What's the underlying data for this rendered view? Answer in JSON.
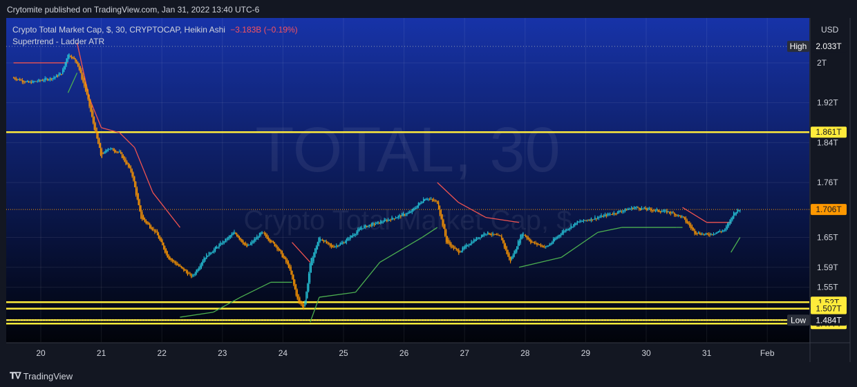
{
  "header": {
    "published_text": "Crytomite published on TradingView.com, Jan 31, 2022 13:40 UTC-6"
  },
  "legend": {
    "symbol": "Crypto Total Market Cap, $, 30, CRYPTOCAP, Heikin Ashi",
    "change": "−3.183B (−0.19%)",
    "indicator": "Supertrend - Ladder ATR"
  },
  "watermark": {
    "line1": "TOTAL, 30",
    "line2": "Crypto Total Market Cap, $"
  },
  "footer": {
    "brand": "TradingView"
  },
  "colors": {
    "background": "#131722",
    "gradient_top": "#1733a8",
    "gradient_bottom": "#010309",
    "candle_up": "#26c6da",
    "candle_down": "#ff9800",
    "supertrend_down": "#ef5350",
    "supertrend_up": "#4caf50",
    "hline": "#ffeb3b",
    "last_price_line": "#ff9800"
  },
  "chart_data": {
    "type": "candlestick",
    "chart_style": "Heikin Ashi",
    "timeframe": "30",
    "currency": "USD",
    "y_scale_labels": [
      "2T",
      "1.92T",
      "1.84T",
      "1.76T",
      "1.65T",
      "1.59T",
      "1.55T"
    ],
    "y_unit_label": "USD",
    "x_tick_labels": [
      "20",
      "21",
      "22",
      "23",
      "24",
      "25",
      "26",
      "27",
      "28",
      "29",
      "30",
      "31",
      "Feb"
    ],
    "price_range_T": [
      1.44,
      2.09
    ],
    "horizontal_lines": [
      {
        "value": 1.861,
        "label": "1.861T"
      },
      {
        "value": 1.52,
        "label": "1.52T"
      },
      {
        "value": 1.507,
        "label": "1.507T"
      },
      {
        "value": 1.484,
        "label": "1.484T"
      },
      {
        "value": 1.477,
        "label": "1.477T"
      }
    ],
    "high": {
      "label": "High",
      "value": 2.033,
      "value_label": "2.033T"
    },
    "low": {
      "label": "Low",
      "value": 1.484,
      "value_label": "1.484T"
    },
    "last_price": {
      "value": 1.706,
      "label": "1.706T"
    },
    "price_path": [
      {
        "day": 19.55,
        "price": 1.97
      },
      {
        "day": 19.8,
        "price": 1.96
      },
      {
        "day": 20.2,
        "price": 1.97
      },
      {
        "day": 20.35,
        "price": 1.98
      },
      {
        "day": 20.45,
        "price": 2.02
      },
      {
        "day": 20.6,
        "price": 2.0
      },
      {
        "day": 20.75,
        "price": 1.94
      },
      {
        "day": 20.9,
        "price": 1.86
      },
      {
        "day": 21.0,
        "price": 1.81
      },
      {
        "day": 21.1,
        "price": 1.83
      },
      {
        "day": 21.3,
        "price": 1.82
      },
      {
        "day": 21.5,
        "price": 1.78
      },
      {
        "day": 21.65,
        "price": 1.69
      },
      {
        "day": 21.9,
        "price": 1.66
      },
      {
        "day": 22.1,
        "price": 1.61
      },
      {
        "day": 22.3,
        "price": 1.59
      },
      {
        "day": 22.5,
        "price": 1.57
      },
      {
        "day": 22.7,
        "price": 1.61
      },
      {
        "day": 23.0,
        "price": 1.64
      },
      {
        "day": 23.2,
        "price": 1.66
      },
      {
        "day": 23.4,
        "price": 1.63
      },
      {
        "day": 23.65,
        "price": 1.66
      },
      {
        "day": 23.9,
        "price": 1.63
      },
      {
        "day": 24.1,
        "price": 1.59
      },
      {
        "day": 24.25,
        "price": 1.52
      },
      {
        "day": 24.35,
        "price": 1.51
      },
      {
        "day": 24.45,
        "price": 1.6
      },
      {
        "day": 24.6,
        "price": 1.65
      },
      {
        "day": 24.8,
        "price": 1.63
      },
      {
        "day": 25.0,
        "price": 1.64
      },
      {
        "day": 25.3,
        "price": 1.67
      },
      {
        "day": 25.6,
        "price": 1.68
      },
      {
        "day": 25.85,
        "price": 1.69
      },
      {
        "day": 26.1,
        "price": 1.7
      },
      {
        "day": 26.35,
        "price": 1.73
      },
      {
        "day": 26.55,
        "price": 1.72
      },
      {
        "day": 26.7,
        "price": 1.64
      },
      {
        "day": 26.9,
        "price": 1.62
      },
      {
        "day": 27.1,
        "price": 1.64
      },
      {
        "day": 27.35,
        "price": 1.66
      },
      {
        "day": 27.6,
        "price": 1.65
      },
      {
        "day": 27.75,
        "price": 1.6
      },
      {
        "day": 27.95,
        "price": 1.66
      },
      {
        "day": 28.1,
        "price": 1.64
      },
      {
        "day": 28.35,
        "price": 1.63
      },
      {
        "day": 28.6,
        "price": 1.66
      },
      {
        "day": 28.85,
        "price": 1.68
      },
      {
        "day": 29.2,
        "price": 1.69
      },
      {
        "day": 29.5,
        "price": 1.7
      },
      {
        "day": 29.8,
        "price": 1.71
      },
      {
        "day": 30.1,
        "price": 1.705
      },
      {
        "day": 30.4,
        "price": 1.7
      },
      {
        "day": 30.6,
        "price": 1.69
      },
      {
        "day": 30.8,
        "price": 1.66
      },
      {
        "day": 31.0,
        "price": 1.655
      },
      {
        "day": 31.3,
        "price": 1.665
      },
      {
        "day": 31.45,
        "price": 1.7
      },
      {
        "day": 31.55,
        "price": 1.706
      }
    ],
    "supertrend": [
      {
        "day": 19.55,
        "price": 2.0,
        "dir": "down"
      },
      {
        "day": 20.45,
        "price": 2.0,
        "dir": "down"
      },
      {
        "day": 20.45,
        "price": 1.94,
        "dir": "up"
      },
      {
        "day": 20.6,
        "price": 1.98,
        "dir": "up"
      },
      {
        "day": 20.6,
        "price": 2.04,
        "dir": "down"
      },
      {
        "day": 20.8,
        "price": 1.93,
        "dir": "down"
      },
      {
        "day": 21.0,
        "price": 1.87,
        "dir": "down"
      },
      {
        "day": 21.3,
        "price": 1.86,
        "dir": "down"
      },
      {
        "day": 21.55,
        "price": 1.83,
        "dir": "down"
      },
      {
        "day": 21.85,
        "price": 1.74,
        "dir": "down"
      },
      {
        "day": 22.3,
        "price": 1.67,
        "dir": "down"
      },
      {
        "day": 22.3,
        "price": 1.49,
        "dir": "up"
      },
      {
        "day": 22.85,
        "price": 1.5,
        "dir": "up"
      },
      {
        "day": 23.3,
        "price": 1.53,
        "dir": "up"
      },
      {
        "day": 23.8,
        "price": 1.56,
        "dir": "up"
      },
      {
        "day": 24.15,
        "price": 1.56,
        "dir": "up"
      },
      {
        "day": 24.15,
        "price": 1.64,
        "dir": "down"
      },
      {
        "day": 24.45,
        "price": 1.6,
        "dir": "down"
      },
      {
        "day": 24.45,
        "price": 1.48,
        "dir": "up"
      },
      {
        "day": 24.6,
        "price": 1.53,
        "dir": "up"
      },
      {
        "day": 25.2,
        "price": 1.54,
        "dir": "up"
      },
      {
        "day": 25.6,
        "price": 1.6,
        "dir": "up"
      },
      {
        "day": 26.3,
        "price": 1.65,
        "dir": "up"
      },
      {
        "day": 26.55,
        "price": 1.67,
        "dir": "up"
      },
      {
        "day": 26.55,
        "price": 1.76,
        "dir": "down"
      },
      {
        "day": 26.9,
        "price": 1.72,
        "dir": "down"
      },
      {
        "day": 27.35,
        "price": 1.69,
        "dir": "down"
      },
      {
        "day": 27.9,
        "price": 1.68,
        "dir": "down"
      },
      {
        "day": 27.9,
        "price": 1.59,
        "dir": "up"
      },
      {
        "day": 28.6,
        "price": 1.61,
        "dir": "up"
      },
      {
        "day": 29.2,
        "price": 1.66,
        "dir": "up"
      },
      {
        "day": 29.6,
        "price": 1.67,
        "dir": "up"
      },
      {
        "day": 30.5,
        "price": 1.67,
        "dir": "up"
      },
      {
        "day": 30.6,
        "price": 1.67,
        "dir": "up"
      },
      {
        "day": 30.6,
        "price": 1.71,
        "dir": "down"
      },
      {
        "day": 31.0,
        "price": 1.68,
        "dir": "down"
      },
      {
        "day": 31.4,
        "price": 1.68,
        "dir": "down"
      },
      {
        "day": 31.4,
        "price": 1.62,
        "dir": "up"
      },
      {
        "day": 31.55,
        "price": 1.65,
        "dir": "up"
      }
    ]
  }
}
